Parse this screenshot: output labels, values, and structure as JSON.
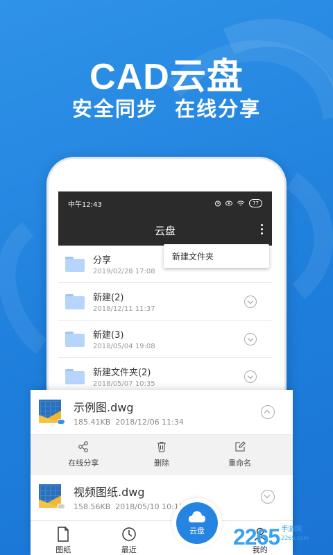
{
  "promo": {
    "title": "CAD云盘",
    "subtitle": "安全同步  在线分享"
  },
  "status_bar": {
    "time": "中午12:43",
    "battery": "77"
  },
  "app_bar": {
    "title": "云盘",
    "more_icon": "more-vertical-icon"
  },
  "popup_menu": {
    "items": [
      "新建文件夹"
    ]
  },
  "folders": [
    {
      "name": "分享",
      "date": "2019/02/28 17:08"
    },
    {
      "name": "新建(2)",
      "date": "2018/12/11 11:37"
    },
    {
      "name": "新建(3)",
      "date": "2018/05/04 19:08"
    },
    {
      "name": "新建文件夹(2)",
      "date": "2018/05/07 10:35"
    }
  ],
  "files": [
    {
      "name": "示例图.dwg",
      "size": "185.41KB",
      "date": "2018/12/06 11:34",
      "expanded": true
    },
    {
      "name": "视频图纸.dwg",
      "size": "158.56KB",
      "date": "2018/05/10 10:15",
      "expanded": false
    }
  ],
  "actions": [
    {
      "label": "在线分享",
      "icon": "share-icon"
    },
    {
      "label": "删除",
      "icon": "trash-icon"
    },
    {
      "label": "重命名",
      "icon": "edit-icon"
    }
  ],
  "tabs": [
    {
      "label": "图纸",
      "icon": "document-icon"
    },
    {
      "label": "最近",
      "icon": "clock-icon"
    },
    {
      "label": "云盘",
      "icon": "cloud-icon",
      "active": true
    },
    {
      "label": "我的",
      "icon": "user-icon"
    }
  ],
  "watermark": {
    "number": "2265",
    "domain": "手游网",
    "url": "2265.com"
  },
  "colors": {
    "background": "#2185e0",
    "accent": "#2584e2",
    "dark_bar": "#2b2b2b"
  }
}
